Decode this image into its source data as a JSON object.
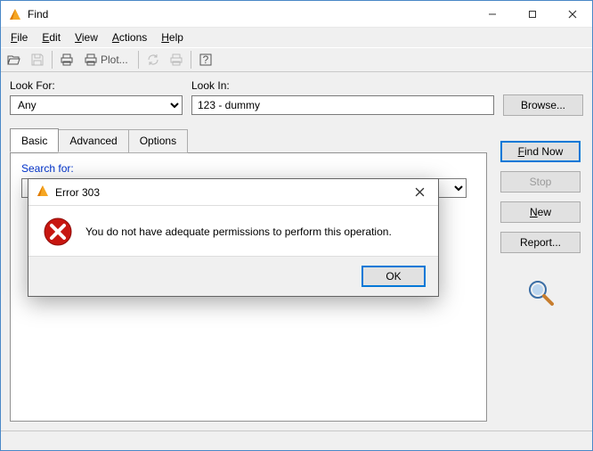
{
  "window": {
    "title": "Find"
  },
  "menu": {
    "file": "File",
    "edit": "Edit",
    "view": "View",
    "actions": "Actions",
    "help": "Help"
  },
  "toolbar": {
    "plot_label": "Plot..."
  },
  "labels": {
    "look_for": "Look For:",
    "look_in": "Look In:",
    "search_for": "Search for:"
  },
  "inputs": {
    "look_for_value": "Any",
    "look_in_value": "123 - dummy",
    "search_for_value": ""
  },
  "buttons": {
    "browse": "Browse...",
    "find_now": "Find Now",
    "stop": "Stop",
    "new": "New",
    "report": "Report..."
  },
  "tabs": {
    "basic": "Basic",
    "advanced": "Advanced",
    "options": "Options"
  },
  "dialog": {
    "title": "Error 303",
    "message": "You do not have adequate permissions to perform this operation.",
    "ok": "OK"
  }
}
